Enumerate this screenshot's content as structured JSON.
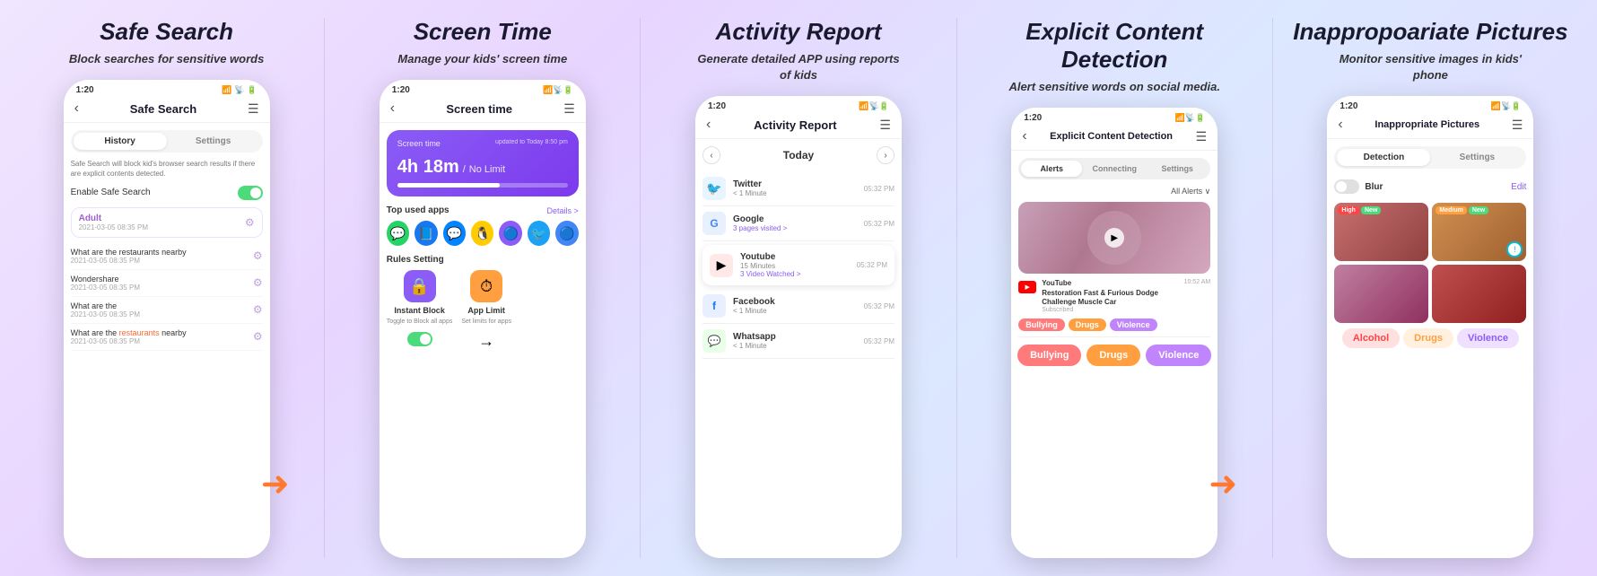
{
  "sections": [
    {
      "id": "safe-search",
      "title": "Safe Search",
      "desc": "Block searches for sensitive words",
      "phone": {
        "time": "1:20",
        "header": "Safe Search",
        "tabs": [
          "History",
          "Settings"
        ],
        "active_tab": 0,
        "note": "Safe Search will block kid's browser search results if there are explicit contents detected.",
        "enable_label": "Enable Safe Search",
        "highlight": {
          "text": "Adult",
          "time": "2021-03-05 08:35 PM"
        },
        "items": [
          {
            "text": "What are the restaurants nearby",
            "time": "2021-03-05 08:35 PM"
          },
          {
            "text": "Wondershare",
            "time": "2021-03-05 08:35 PM"
          },
          {
            "text": "What are the",
            "time": "2021-03-05 08:35 PM"
          },
          {
            "text": "What are the restaurants nearby",
            "time": "2021-03-05 08:35 PM",
            "has_link": true
          }
        ]
      },
      "has_arrow": true
    },
    {
      "id": "screen-time",
      "title": "Screen Time",
      "desc": "Manage your kids' screen time",
      "phone": {
        "time": "1:20",
        "header": "Screen time",
        "screen_time": {
          "label": "Screen time",
          "updated": "updated to Today 8:50 pm",
          "value": "4h 18m",
          "limit": "No Limit",
          "progress": 60
        },
        "top_apps_label": "Top used apps",
        "details_label": "Details >",
        "apps": [
          "💬",
          "📘",
          "💬",
          "🐧",
          "🟣",
          "🐦",
          "🔵"
        ],
        "rules_label": "Rules Setting",
        "rules": [
          {
            "name": "Instant Block",
            "desc": "Toggle to Block all apps",
            "color": "#8b5cf6",
            "icon": "🔒"
          },
          {
            "name": "App Limit",
            "desc": "Set limits for apps",
            "color": "#ff9f40",
            "icon": "⏱"
          }
        ]
      }
    },
    {
      "id": "activity-report",
      "title": "Activity Report",
      "desc": "Generate detailed APP using reports of kids",
      "phone": {
        "time": "1:20",
        "header": "Activity Report",
        "period": "Today",
        "items": [
          {
            "app": "Twitter",
            "icon": "🐦",
            "icon_color": "#1da1f2",
            "time": "05:32 PM",
            "sub": "< 1 Minute"
          },
          {
            "app": "Google",
            "icon": "G",
            "icon_color": "#4285f4",
            "time": "05:32 PM",
            "sub": "3 pages visited >"
          },
          {
            "app": "Youtube",
            "icon": "▶",
            "icon_color": "#ff0000",
            "time": "05:32 PM",
            "sub": "15 Minutes",
            "sub2": "3 Video Watched >",
            "highlighted": true
          },
          {
            "app": "Facebook",
            "icon": "f",
            "icon_color": "#1877f2",
            "time": "05:32 PM",
            "sub": "< 1 Minute"
          },
          {
            "app": "Whatsapp",
            "icon": "W",
            "icon_color": "#25d366",
            "time": "05:32 PM",
            "sub": "< 1 Minute"
          }
        ]
      }
    },
    {
      "id": "explicit-content",
      "title": "Explicit Content Detection",
      "desc": "Alert sensitive words on social media.",
      "phone": {
        "time": "1:20",
        "header": "Explicit Content Detection",
        "tabs": [
          "Alerts",
          "Connecting",
          "Settings"
        ],
        "active_tab": 0,
        "all_alerts": "All Alerts ∨",
        "video": {
          "youtube_label": "YouTube",
          "time": "10:52 AM",
          "title": "Restoration Fast & Furious Dodge Challenge Muscle Car",
          "sub": "Subscribed",
          "tags": [
            "Bullying",
            "Drugs",
            "Violence"
          ]
        },
        "bottom_tags": [
          "Bullying",
          "Drugs",
          "Violence"
        ]
      },
      "has_arrow": true
    },
    {
      "id": "inappropriate-pictures",
      "title": "Inappropoariate Pictures",
      "desc": "Monitor sensitive images in kids' phone",
      "phone": {
        "time": "1:20",
        "header": "Inappropriate Pictures",
        "tabs": [
          "Detection",
          "Settings"
        ],
        "active_tab": 0,
        "blur_label": "Blur",
        "edit_label": "Edit",
        "images": [
          {
            "badges": [
              "High",
              "New"
            ],
            "has_alert": false,
            "gradient": "linear-gradient(135deg, #c87070, #904040)"
          },
          {
            "badges": [
              "Medium",
              "New"
            ],
            "has_alert": true,
            "gradient": "linear-gradient(135deg, #d09050, #a06030)"
          },
          {
            "badges": [],
            "has_alert": false,
            "gradient": "linear-gradient(135deg, #c080a0, #903060)"
          },
          {
            "badges": [],
            "has_alert": false,
            "gradient": "linear-gradient(135deg, #c05050, #902020)"
          }
        ],
        "bottom_tags": [
          {
            "label": "Alcohol",
            "type": "alcohol"
          },
          {
            "label": "Drugs",
            "type": "drugs"
          },
          {
            "label": "Violence",
            "type": "violence"
          }
        ]
      }
    }
  ]
}
